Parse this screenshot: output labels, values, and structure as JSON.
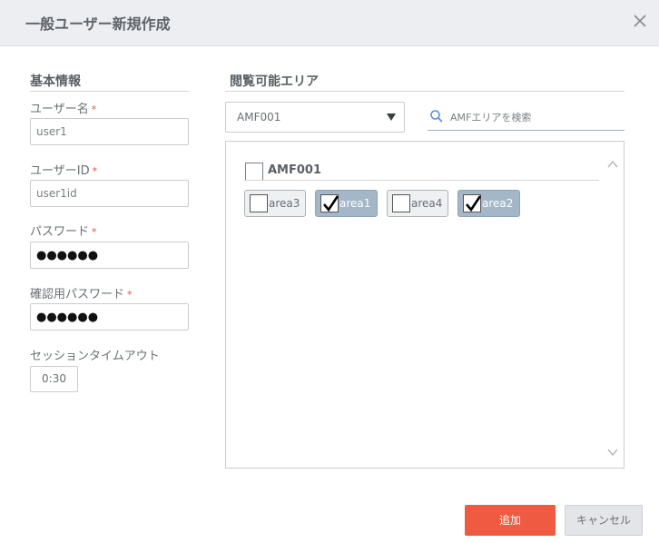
{
  "dialog": {
    "title": "一般ユーザー新規作成"
  },
  "basic": {
    "section_title": "基本情報",
    "required_mark": "*",
    "username": {
      "label": "ユーザー名",
      "value": "user1"
    },
    "userid": {
      "label": "ユーザーID",
      "value": "user1id"
    },
    "password": {
      "label": "パスワード",
      "value": "●●●●●●"
    },
    "password_confirm": {
      "label": "確認用パスワード",
      "value": "●●●●●●"
    },
    "session": {
      "label": "セッションタイムアウト",
      "value": "0:30"
    }
  },
  "areas": {
    "section_title": "閲覧可能エリア",
    "select_value": "AMF001",
    "search_placeholder": "AMFエリアを検索",
    "group": {
      "name": "AMF001",
      "checked": false
    },
    "chips": [
      {
        "label": "area3",
        "checked": false
      },
      {
        "label": "area1",
        "checked": true
      },
      {
        "label": "area4",
        "checked": false
      },
      {
        "label": "area2",
        "checked": true
      }
    ]
  },
  "actions": {
    "add_label": "追加",
    "cancel_label": "キャンセル"
  },
  "colors": {
    "accent": "#ef5a42",
    "selected_chip": "#a4b7c8",
    "required": "#e0513f"
  },
  "icons": {
    "close": "close-icon",
    "search": "search-icon",
    "dropdown": "chevron-down-icon"
  }
}
